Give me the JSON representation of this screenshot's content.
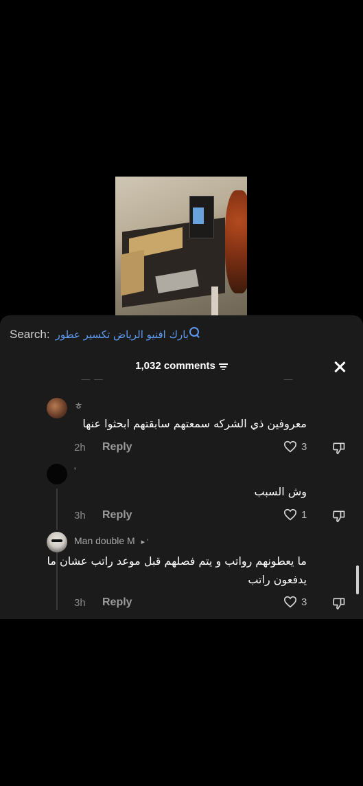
{
  "search": {
    "label": "Search:",
    "term": "بارك افنيو الرياض تكسير عطور"
  },
  "header": {
    "comment_count": "1,032 comments"
  },
  "comments": [
    {
      "username": "ㅎ",
      "text": "معروفين ذي الشركه سمعتهم سابقتهم ابحثوا عنها",
      "time": "2h",
      "reply": "Reply",
      "likes": "3"
    },
    {
      "username": "'",
      "text": "وش السبب",
      "time": "3h",
      "reply": "Reply",
      "likes": "1"
    },
    {
      "username": "Man double M",
      "username_suffix": "▸ '",
      "text": "ما يعطونهم رواتب و يتم فصلهم قبل موعد راتب عشان ما يدفعون راتب",
      "time": "3h",
      "reply": "Reply",
      "likes": "3"
    }
  ],
  "colors": {
    "accent": "#5e9bf0",
    "panel": "#1b1b1b"
  }
}
